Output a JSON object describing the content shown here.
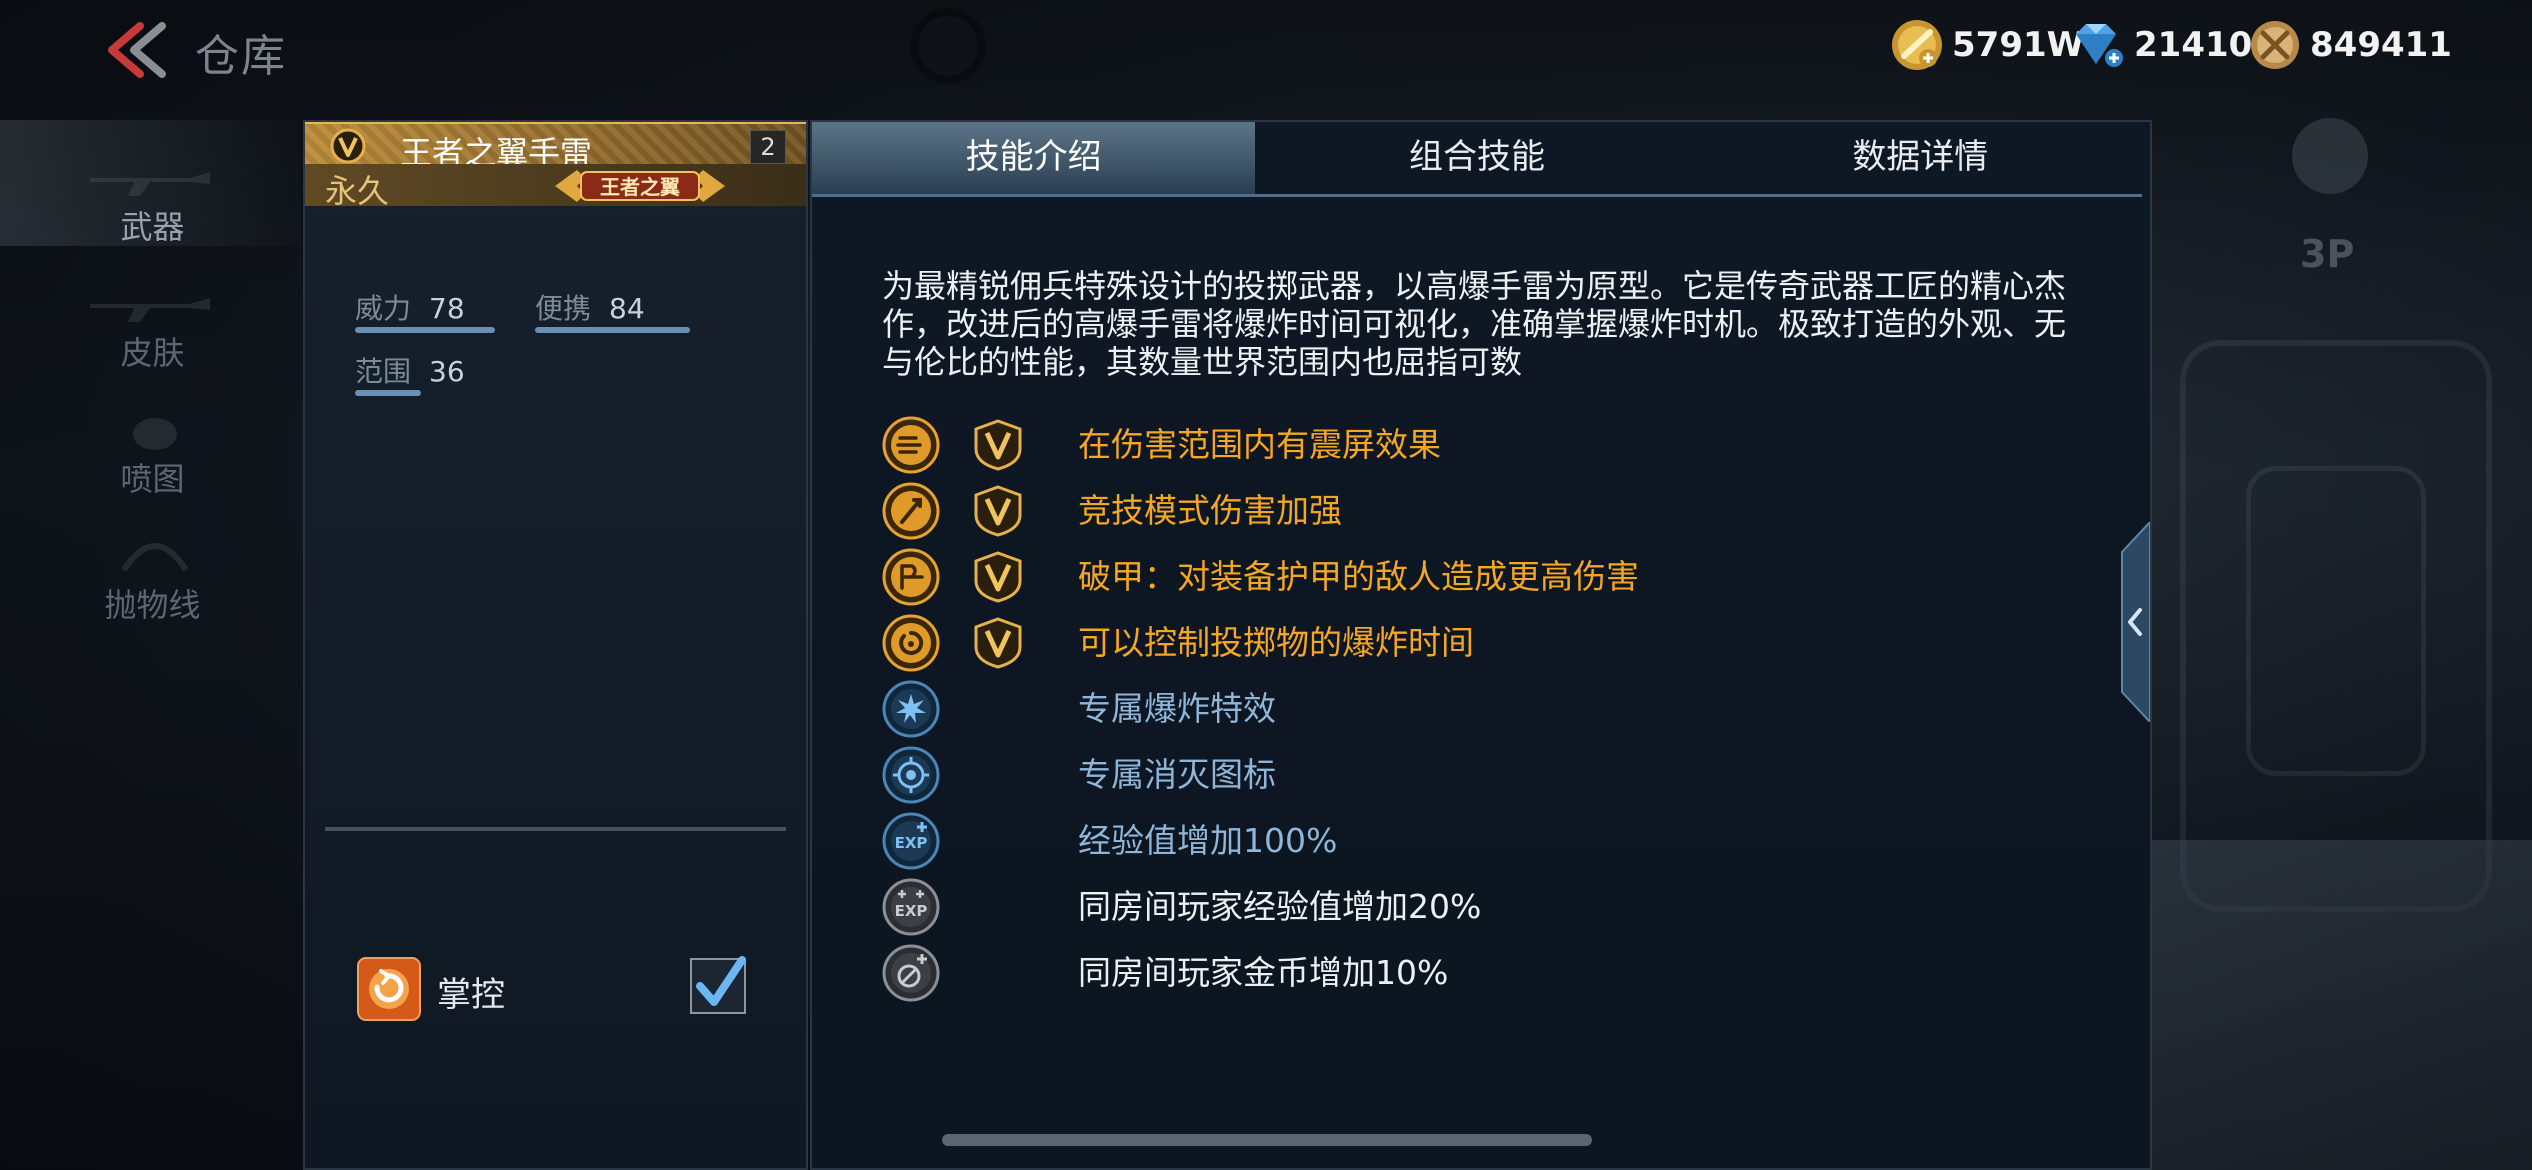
{
  "page": {
    "title": "仓库"
  },
  "currencies": [
    {
      "name": "gold-coin",
      "value": "5791W",
      "color": "#e0b24a"
    },
    {
      "name": "diamond",
      "value": "21410",
      "color": "#5fb0f0"
    },
    {
      "name": "honor-medal",
      "value": "849411",
      "color": "#d8b070"
    }
  ],
  "sidenav": {
    "items": [
      {
        "label": "武器",
        "active": true
      },
      {
        "label": "皮肤",
        "active": false
      },
      {
        "label": "喷图",
        "active": false
      },
      {
        "label": "抛物线",
        "active": false
      }
    ]
  },
  "weapon": {
    "name": "王者之翼手雷",
    "level": "2",
    "duration": "永久",
    "brand_badge": "王者之翼",
    "stats": [
      {
        "name": "威力",
        "value": "78"
      },
      {
        "name": "便携",
        "value": "84"
      },
      {
        "name": "范围",
        "value": "36"
      }
    ],
    "mastery": {
      "label": "掌控",
      "checked": true
    }
  },
  "detail": {
    "tabs": [
      {
        "label": "技能介绍",
        "active": true
      },
      {
        "label": "组合技能",
        "active": false
      },
      {
        "label": "数据详情",
        "active": false
      }
    ],
    "description": "为最精锐佣兵特殊设计的投掷武器，以高爆手雷为原型。它是传奇武器工匠的精心杰作，改进后的高爆手雷将爆炸时间可视化，准确掌握爆炸时机。极致打造的外观、无与伦比的性能，其数量世界范围内也屈指可数",
    "skills": [
      {
        "icon": "screen-shake-icon",
        "text": "在伤害范围内有震屏效果",
        "style": "gold",
        "vip": true
      },
      {
        "icon": "competitive-damage-icon",
        "text": "竞技模式伤害加强",
        "style": "gold",
        "vip": true
      },
      {
        "icon": "armor-piercing-icon",
        "text": "破甲：对装备护甲的敌人造成更高伤害",
        "style": "gold",
        "vip": true
      },
      {
        "icon": "timer-control-icon",
        "text": "可以控制投掷物的爆炸时间",
        "style": "gold",
        "vip": true
      },
      {
        "icon": "explosion-effect-icon",
        "text": "专属爆炸特效",
        "style": "blue",
        "vip": false
      },
      {
        "icon": "kill-icon-icon",
        "text": "专属消灭图标",
        "style": "blue",
        "vip": false
      },
      {
        "icon": "exp-boost-icon",
        "text": "经验值增加100%",
        "style": "blue",
        "vip": false
      },
      {
        "icon": "room-exp-boost-icon",
        "text": "同房间玩家经验值增加20%",
        "style": "white",
        "vip": false
      },
      {
        "icon": "room-gold-boost-icon",
        "text": "同房间玩家金币增加10%",
        "style": "white",
        "vip": false
      }
    ]
  },
  "overlay": {
    "view_toggle": "3P"
  }
}
